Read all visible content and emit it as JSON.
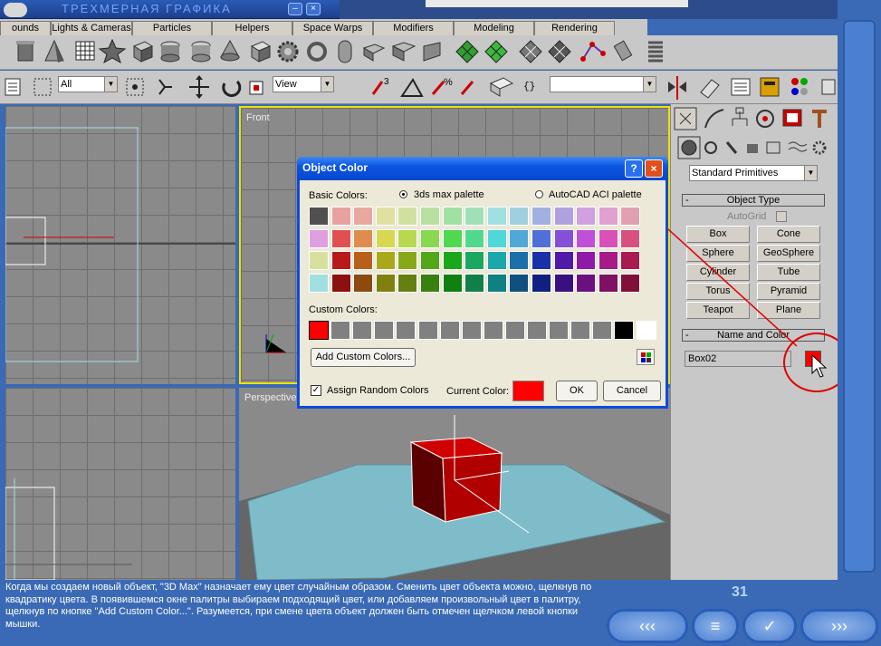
{
  "app": {
    "title": "ТРЕХМЕРНАЯ ГРАФИКА",
    "minimize": "–",
    "close": "×"
  },
  "tabs": [
    "ounds",
    "Lights & Cameras",
    "Particles",
    "Helpers",
    "Space Warps",
    "Modifiers",
    "Modeling",
    "Rendering"
  ],
  "toolbar2": {
    "selection_filter": "All",
    "coord_system": "View",
    "named_selection": ""
  },
  "viewports": {
    "front": "Front",
    "perspective": "Perspective"
  },
  "panel": {
    "category": "Standard Primitives",
    "object_type_header": "Object Type",
    "autogrid": "AutoGrid",
    "buttons": [
      "Box",
      "Cone",
      "Sphere",
      "GeoSphere",
      "Cylinder",
      "Tube",
      "Torus",
      "Pyramid",
      "Teapot",
      "Plane"
    ],
    "name_color_header": "Name and Color",
    "object_name": "Box02",
    "object_color": "#ff0000"
  },
  "dialog": {
    "title": "Object Color",
    "help": "?",
    "close": "×",
    "basic_colors_label": "Basic Colors:",
    "palette_option_1": "3ds max palette",
    "palette_option_2": "AutoCAD ACI palette",
    "selected_palette": "3ds max palette",
    "basic_colors": [
      [
        "#505050",
        "#e8a0a0",
        "#e8a8a0",
        "#e0e0a0",
        "#d0e0a0",
        "#b8e0a0",
        "#a0e0a0",
        "#a0e0b8",
        "#a0e0e0",
        "#a0d0e0",
        "#a0b0e0",
        "#b0a0e0",
        "#d0a0e0",
        "#e0a0d0",
        "#e0a0b0"
      ],
      [
        "#e0a0e0",
        "#e05050",
        "#e08c50",
        "#d8d850",
        "#b8d850",
        "#88d850",
        "#50d850",
        "#50d88c",
        "#50d8d8",
        "#50a8d8",
        "#5070d8",
        "#8450d8",
        "#c050d8",
        "#d850b8",
        "#d85080"
      ],
      [
        "#d8e0a0",
        "#b81a1a",
        "#b8601a",
        "#a8a81a",
        "#88a81a",
        "#50a81a",
        "#1aa81a",
        "#1aa860",
        "#1aa8a8",
        "#1a70a8",
        "#1a30a8",
        "#501aa8",
        "#901aa8",
        "#a81a88",
        "#a81a50"
      ],
      [
        "#a0e0e0",
        "#8c1010",
        "#8c4a10",
        "#808010",
        "#648010",
        "#388010",
        "#108010",
        "#108048",
        "#108080",
        "#105080",
        "#102080",
        "#3a1080",
        "#6c1080",
        "#801064",
        "#80103a"
      ]
    ],
    "custom_colors_label": "Custom Colors:",
    "custom_colors": [
      "#ff0000",
      "#808080",
      "#808080",
      "#808080",
      "#808080",
      "#808080",
      "#808080",
      "#808080",
      "#808080",
      "#808080",
      "#808080",
      "#808080",
      "#808080",
      "#808080",
      "#000000",
      "#ffffff"
    ],
    "add_custom_button": "Add Custom Colors...",
    "assign_random_label": "Assign Random Colors",
    "assign_random_checked": true,
    "current_color_label": "Current Color:",
    "current_color": "#ff0000",
    "ok": "OK",
    "cancel": "Cancel"
  },
  "footer": {
    "text": "Когда мы создаем новый объект, \"3D Max\" назначает ему цвет случайным образом. Сменить цвет объекта можно, щелкнув по квадратику цвета. В появившемся окне палитры выбираем подходящий цвет, или добавляем произвольный цвет в палитру, щелкнув по кнопке \"Add Custom Color...\". Разумеется, при смене цвета объект должен быть отмечен щелчком левой кнопки мышки.",
    "page": "31",
    "nav": {
      "prev": "‹‹‹",
      "menu": "≡",
      "check": "✓",
      "next": "›››"
    }
  }
}
